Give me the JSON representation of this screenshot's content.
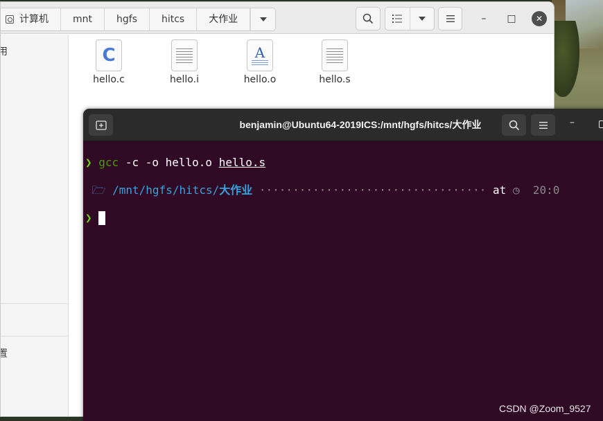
{
  "files_window": {
    "path": [
      "计算机",
      "mnt",
      "hgfs",
      "hitcs",
      "大作业"
    ],
    "sidebar_fragments": [
      "用",
      "置"
    ],
    "files": [
      {
        "name": "hello.c",
        "icon": "c-source-file-icon"
      },
      {
        "name": "hello.i",
        "icon": "text-file-icon"
      },
      {
        "name": "hello.o",
        "icon": "document-file-icon"
      },
      {
        "name": "hello.s",
        "icon": "text-file-icon"
      }
    ],
    "controls": {
      "minimize": "–",
      "maximize": "□",
      "close": "✕"
    }
  },
  "terminal": {
    "title": "benjamin@Ubuntu64-2019ICS:/mnt/hgfs/hitcs/大作业",
    "line1": {
      "prompt": "❯",
      "cmd": "gcc",
      "args": " -c -o hello.o ",
      "file": "hello.s"
    },
    "line2": {
      "os_icon": "",
      "folder_icon": "🗁",
      "path_main": "/mnt/hgfs/hitcs/",
      "path_bold": "大作业",
      "dots": " ·································· ",
      "at": "at",
      "clock_icon": "◷",
      "time": "20:0"
    },
    "line3": {
      "prompt": "❯"
    }
  },
  "watermark": "CSDN @Zoom_9527"
}
